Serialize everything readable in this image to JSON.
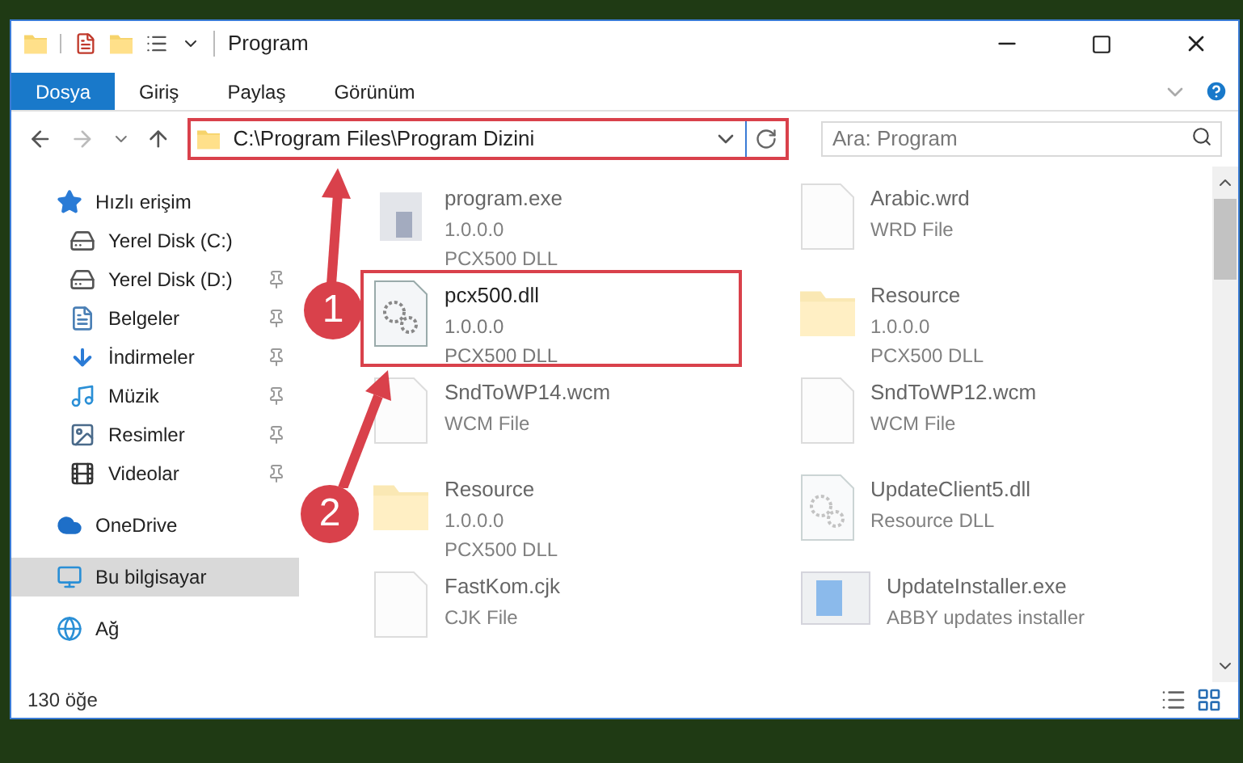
{
  "window": {
    "title": "Program"
  },
  "ribbon_tabs": [
    {
      "label": "Dosya",
      "selected": true
    },
    {
      "label": "Giriş",
      "selected": false
    },
    {
      "label": "Paylaş",
      "selected": false
    },
    {
      "label": "Görünüm",
      "selected": false
    }
  ],
  "address_bar": {
    "path": "C:\\Program Files\\Program Dizini",
    "highlighted": true
  },
  "search": {
    "placeholder": "Ara: Program"
  },
  "sidebar": {
    "items": [
      {
        "label": "Hızlı erişim",
        "kind": "star",
        "selected": false,
        "children": [
          {
            "label": "Yerel Disk (C:)",
            "kind": "drive",
            "pinned": false,
            "selected": false
          },
          {
            "label": "Yerel Disk (D:)",
            "kind": "drive",
            "pinned": true,
            "selected": false
          },
          {
            "label": "Belgeler",
            "kind": "document",
            "pinned": true,
            "selected": false
          },
          {
            "label": "İndirmeler",
            "kind": "download",
            "pinned": true,
            "selected": false
          },
          {
            "label": "Müzik",
            "kind": "music",
            "pinned": true,
            "selected": false
          },
          {
            "label": "Resimler",
            "kind": "pictures",
            "pinned": true,
            "selected": false
          },
          {
            "label": "Videolar",
            "kind": "video",
            "pinned": true,
            "selected": false
          }
        ]
      },
      {
        "label": "OneDrive",
        "kind": "cloud",
        "selected": false
      },
      {
        "label": "Bu bilgisayar",
        "kind": "computer",
        "selected": true
      },
      {
        "label": "Ağ",
        "kind": "network",
        "selected": false
      }
    ]
  },
  "files": [
    {
      "name": "program.exe",
      "details": [
        "1.0.0.0",
        "PCX500 DLL"
      ],
      "kind": "exe",
      "faded": true,
      "highlighted": false
    },
    {
      "name": "Arabic.wrd",
      "details": [
        "WRD File"
      ],
      "kind": "blank",
      "faded": true,
      "highlighted": false
    },
    {
      "name": "pcx500.dll",
      "details": [
        "1.0.0.0",
        "PCX500 DLL"
      ],
      "kind": "gears",
      "faded": false,
      "highlighted": true
    },
    {
      "name": "Resource",
      "details": [
        "1.0.0.0",
        "PCX500 DLL"
      ],
      "kind": "folder",
      "faded": true,
      "highlighted": false
    },
    {
      "name": "SndToWP14.wcm",
      "details": [
        "WCM File"
      ],
      "kind": "blank",
      "faded": true,
      "highlighted": false
    },
    {
      "name": "SndToWP12.wcm",
      "details": [
        "WCM File"
      ],
      "kind": "blank",
      "faded": true,
      "highlighted": false
    },
    {
      "name": "Resource",
      "details": [
        "1.0.0.0",
        "PCX500 DLL"
      ],
      "kind": "folder",
      "faded": true,
      "highlighted": false
    },
    {
      "name": "UpdateClient5.dll",
      "details": [
        "Resource DLL"
      ],
      "kind": "gears",
      "faded": true,
      "highlighted": false
    },
    {
      "name": "FastKom.cjk",
      "details": [
        "CJK File"
      ],
      "kind": "blank",
      "faded": true,
      "highlighted": false
    },
    {
      "name": "UpdateInstaller.exe",
      "details": [
        "ABBY updates installer"
      ],
      "kind": "installer",
      "faded": true,
      "highlighted": false
    }
  ],
  "status_bar": {
    "count": "130 öğe"
  },
  "annotations": [
    {
      "label": "1"
    },
    {
      "label": "2"
    }
  ]
}
